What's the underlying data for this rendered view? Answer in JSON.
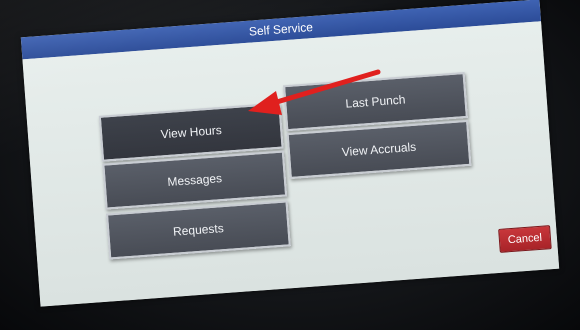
{
  "window": {
    "title": "Self Service"
  },
  "menu": {
    "view_hours": "View Hours",
    "last_punch": "Last Punch",
    "messages": "Messages",
    "view_accruals": "View Accruals",
    "requests": "Requests"
  },
  "actions": {
    "cancel": "Cancel"
  },
  "colors": {
    "titlebar": "#2c4c98",
    "button": "#4e525b",
    "cancel": "#b8282d",
    "annotation_arrow": "#e0201e"
  },
  "annotation": {
    "icon": "arrow-icon",
    "points_to": "View Hours"
  }
}
